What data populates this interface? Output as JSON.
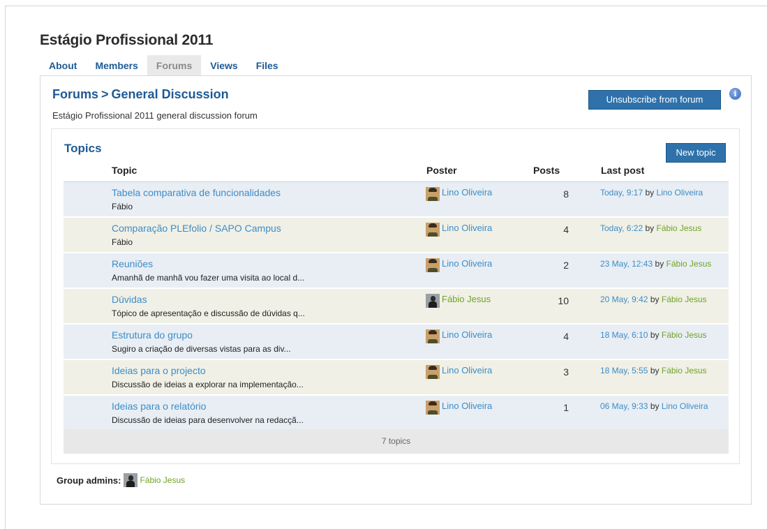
{
  "group": {
    "title": "Estágio Profissional 2011"
  },
  "tabs": [
    {
      "label": "About"
    },
    {
      "label": "Members"
    },
    {
      "label": "Forums"
    },
    {
      "label": "Views"
    },
    {
      "label": "Files"
    }
  ],
  "active_tab": "Forums",
  "forum": {
    "breadcrumb_root": "Forums",
    "breadcrumb_separator": ">",
    "name": "General Discussion",
    "description": "Estágio Profissional 2011 general discussion forum",
    "unsubscribe_label": "Unsubscribe from forum",
    "info_icon": "info-icon"
  },
  "topics": {
    "heading": "Topics",
    "new_topic_label": "New topic",
    "columns": {
      "topic": "Topic",
      "poster": "Poster",
      "posts": "Posts",
      "last_post": "Last post"
    },
    "rows": [
      {
        "title": "Tabela comparativa de funcionalidades",
        "excerpt": "Fábio",
        "poster": "Lino Oliveira",
        "poster_avatar": "lino",
        "posts": "8",
        "last_date": "Today, 9:17",
        "by": "by",
        "last_by": "Lino Oliveira",
        "last_by_color": "#3d8cc7"
      },
      {
        "title": "Comparação PLEfolio / SAPO Campus",
        "excerpt": "Fábio",
        "poster": "Lino Oliveira",
        "poster_avatar": "lino",
        "posts": "4",
        "last_date": "Today, 6:22",
        "by": "by",
        "last_by": "Fábio Jesus",
        "last_by_color": "#6fa324"
      },
      {
        "title": "Reuniões",
        "excerpt": "Amanhã de manhã vou fazer uma visita ao local d...",
        "poster": "Lino Oliveira",
        "poster_avatar": "lino",
        "posts": "2",
        "last_date": "23 May, 12:43",
        "by": "by",
        "last_by": "Fábio Jesus",
        "last_by_color": "#6fa324"
      },
      {
        "title": "Dúvidas",
        "excerpt": "Tópico de apresentação e discussão de dúvidas q...",
        "poster": "Fábio Jesus",
        "poster_avatar": "fabio",
        "posts": "10",
        "last_date": "20 May, 9:42",
        "by": "by",
        "last_by": "Fábio Jesus",
        "last_by_color": "#6fa324"
      },
      {
        "title": "Estrutura do grupo",
        "excerpt": "Sugiro a criação de diversas vistas para as div...",
        "poster": "Lino Oliveira",
        "poster_avatar": "lino",
        "posts": "4",
        "last_date": "18 May, 6:10",
        "by": "by",
        "last_by": "Fábio Jesus",
        "last_by_color": "#6fa324"
      },
      {
        "title": "Ideias para o projecto",
        "excerpt": "Discussão de ideias a explorar na implementação...",
        "poster": "Lino Oliveira",
        "poster_avatar": "lino",
        "posts": "3",
        "last_date": "18 May, 5:55",
        "by": "by",
        "last_by": "Fábio Jesus",
        "last_by_color": "#6fa324"
      },
      {
        "title": "Ideias para o relatório",
        "excerpt": "Discussão de ideias para desenvolver na redacçã...",
        "poster": "Lino Oliveira",
        "poster_avatar": "lino",
        "posts": "1",
        "last_date": "06 May, 9:33",
        "by": "by",
        "last_by": "Lino Oliveira",
        "last_by_color": "#3d8cc7"
      }
    ],
    "count_label": "7 topics"
  },
  "admins": {
    "label": "Group admins:",
    "members": [
      {
        "name": "Fábio Jesus",
        "avatar": "fabio"
      }
    ]
  },
  "colors": {
    "accent": "#1e5a95",
    "link_blue": "#3d8cc7",
    "link_green": "#6fa324",
    "button": "#2f72ab",
    "row_odd": "#e8eef4",
    "row_even": "#f0f0e6"
  }
}
